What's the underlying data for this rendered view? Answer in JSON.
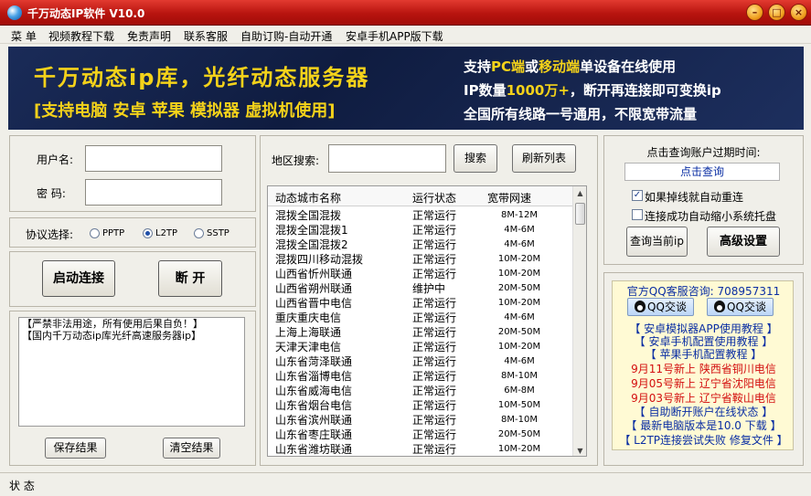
{
  "window": {
    "title": "千万动态IP软件 V10.0",
    "min_label": "–",
    "max_label": "□",
    "close_label": "×"
  },
  "menu": [
    "菜 单",
    "视频教程下载",
    "免责声明",
    "联系客服",
    "自助订购-自动开通",
    "安卓手机APP版下载"
  ],
  "banner": {
    "left_line1": "千万动态ip库，光纤动态服务器",
    "left_line2": "[支持电脑 安卓 苹果 模拟器 虚拟机使用]",
    "right_line1_a": "支持",
    "right_line1_b": "PC端",
    "right_line1_c": "或",
    "right_line1_d": "移动端",
    "right_line1_e": "单设备在线使用",
    "right_line2_a": "IP数量",
    "right_line2_b": "1000万+",
    "right_line2_c": "，断开再连接即可变换ip",
    "right_line3": "全国所有线路一号通用，不限宽带流量"
  },
  "login": {
    "username_label": "用户名:",
    "password_label": "密  码:",
    "username_value": "",
    "password_value": ""
  },
  "protocol": {
    "label": "协议选择:",
    "options": [
      "PPTP",
      "L2TP",
      "SSTP"
    ],
    "selected": "L2TP"
  },
  "actions": {
    "connect": "启动连接",
    "disconnect": "断 开"
  },
  "log": {
    "lines": [
      "【严禁非法用途，所有使用后果自负！】",
      "【国内千万动态ip库光纤高速服务器ip】"
    ],
    "save_label": "保存结果",
    "clear_label": "清空结果"
  },
  "search": {
    "label": "地区搜索:",
    "value": "",
    "search_button": "搜索",
    "refresh_button": "刷新列表"
  },
  "table": {
    "headers": [
      "动态城市名称",
      "运行状态",
      "宽带网速"
    ],
    "rows": [
      [
        "混拨全国混拨",
        "正常运行",
        "8M-12M"
      ],
      [
        "混拨全国混拨1",
        "正常运行",
        "4M-6M"
      ],
      [
        "混拨全国混拨2",
        "正常运行",
        "4M-6M"
      ],
      [
        "混拨四川移动混拨",
        "正常运行",
        "10M-20M"
      ],
      [
        "山西省忻州联通",
        "正常运行",
        "10M-20M"
      ],
      [
        "山西省朔州联通",
        "维护中",
        "20M-50M"
      ],
      [
        "山西省晋中电信",
        "正常运行",
        "10M-20M"
      ],
      [
        "重庆重庆电信",
        "正常运行",
        "4M-6M"
      ],
      [
        "上海上海联通",
        "正常运行",
        "20M-50M"
      ],
      [
        "天津天津电信",
        "正常运行",
        "10M-20M"
      ],
      [
        "山东省菏泽联通",
        "正常运行",
        "4M-6M"
      ],
      [
        "山东省淄博电信",
        "正常运行",
        "8M-10M"
      ],
      [
        "山东省威海电信",
        "正常运行",
        "6M-8M"
      ],
      [
        "山东省烟台电信",
        "正常运行",
        "10M-50M"
      ],
      [
        "山东省滨州联通",
        "正常运行",
        "8M-10M"
      ],
      [
        "山东省枣庄联通",
        "正常运行",
        "20M-50M"
      ],
      [
        "山东省潍坊联通",
        "正常运行",
        "10M-20M"
      ]
    ]
  },
  "account": {
    "expiry_label": "点击查询账户过期时间:",
    "expiry_link": "点击查询",
    "auto_reconnect": "如果掉线就自动重连",
    "auto_reconnect_checked": true,
    "minimize_tray": "连接成功自动缩小系统托盘",
    "minimize_tray_checked": false,
    "query_ip_button": "查询当前ip",
    "advanced_button": "高级设置"
  },
  "info": {
    "qq_line": "官方QQ客服咨询: 708957311",
    "qq_btn1": "QQ交谈",
    "qq_btn2": "QQ交谈",
    "links": [
      "【 安卓模拟器APP使用教程 】",
      "【 安卓手机配置使用教程 】",
      "【 苹果手机配置教程 】"
    ],
    "news": [
      "9月11号新上  陕西省铜川电信",
      "9月05号新上  辽宁省沈阳电信",
      "9月03号新上  辽宁省鞍山电信"
    ],
    "links2": [
      "【 自助断开账户在线状态 】",
      "【 最新电脑版本是10.0 下载 】",
      "【 L2TP连接尝试失败 修复文件 】"
    ]
  },
  "status": {
    "label": "状 态"
  }
}
